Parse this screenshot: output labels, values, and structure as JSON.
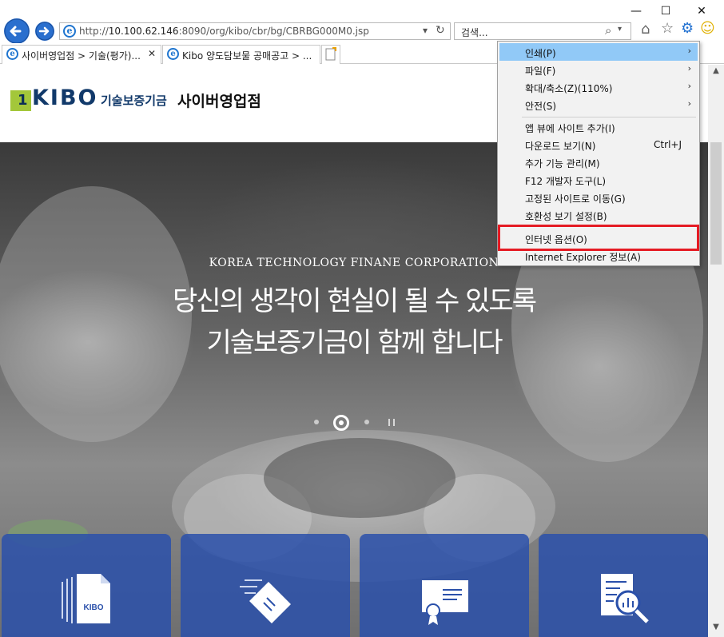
{
  "window": {
    "minimize": "—",
    "maximize": "☐",
    "close": "✕"
  },
  "toolbar": {
    "back_icon": "arrow-left",
    "forward_icon": "arrow-right",
    "url_prefix": "http://",
    "url_host": "10.100.62.146",
    "url_rest": ":8090/org/kibo/cbr/bg/CBRBG000M0.jsp",
    "search_placeholder": "검색...",
    "search_icon": "⌕",
    "refresh_icon": "↻",
    "dropdown_icon": "▾",
    "home_icon": "⌂",
    "favorites_icon": "☆",
    "tools_icon": "⚙",
    "feedback_icon": "☺"
  },
  "tabs": [
    {
      "label": "사이버영업점 > 기술(평가)...",
      "close": "✕"
    },
    {
      "label": "Kibo 양도담보물 공매공고 > ..."
    }
  ],
  "site": {
    "logo_mark": "1",
    "logo_kibo": "KIBO",
    "logo_kr": "기술보증기금",
    "logo_site": "사이버영업점",
    "hero_en": "KOREA TECHNOLOGY FINANE CORPORATION",
    "hero_line1": "당신의 생각이 현실이 될 수 있도록",
    "hero_line2": "기술보증기금이 함께 합니다",
    "card1_badge": "KIBO"
  },
  "menu": {
    "items": [
      {
        "label": "인쇄(P)",
        "submenu": "›",
        "highlighted": true
      },
      {
        "label": "파일(F)",
        "submenu": "›"
      },
      {
        "label": "확대/축소(Z)(110%)",
        "submenu": "›"
      },
      {
        "label": "안전(S)",
        "submenu": "›"
      },
      {
        "label": "앱 뷰에 사이트 추가(I)"
      },
      {
        "label": "다운로드 보기(N)",
        "shortcut": "Ctrl+J"
      },
      {
        "label": "추가 기능 관리(M)"
      },
      {
        "label": "F12 개발자 도구(L)"
      },
      {
        "label": "고정된 사이트로 이동(G)"
      },
      {
        "label": "호환성 보기 설정(B)"
      },
      {
        "label": "인터넷 옵션(O)",
        "highlight_box_color": "#e51b24"
      },
      {
        "label": "Internet Explorer 정보(A)"
      }
    ]
  },
  "colors": {
    "accent": "#2a6fce",
    "menu_highlight": "#91c9f7",
    "card_blue": "#2a50aa",
    "annotation_red": "#e51b24"
  }
}
